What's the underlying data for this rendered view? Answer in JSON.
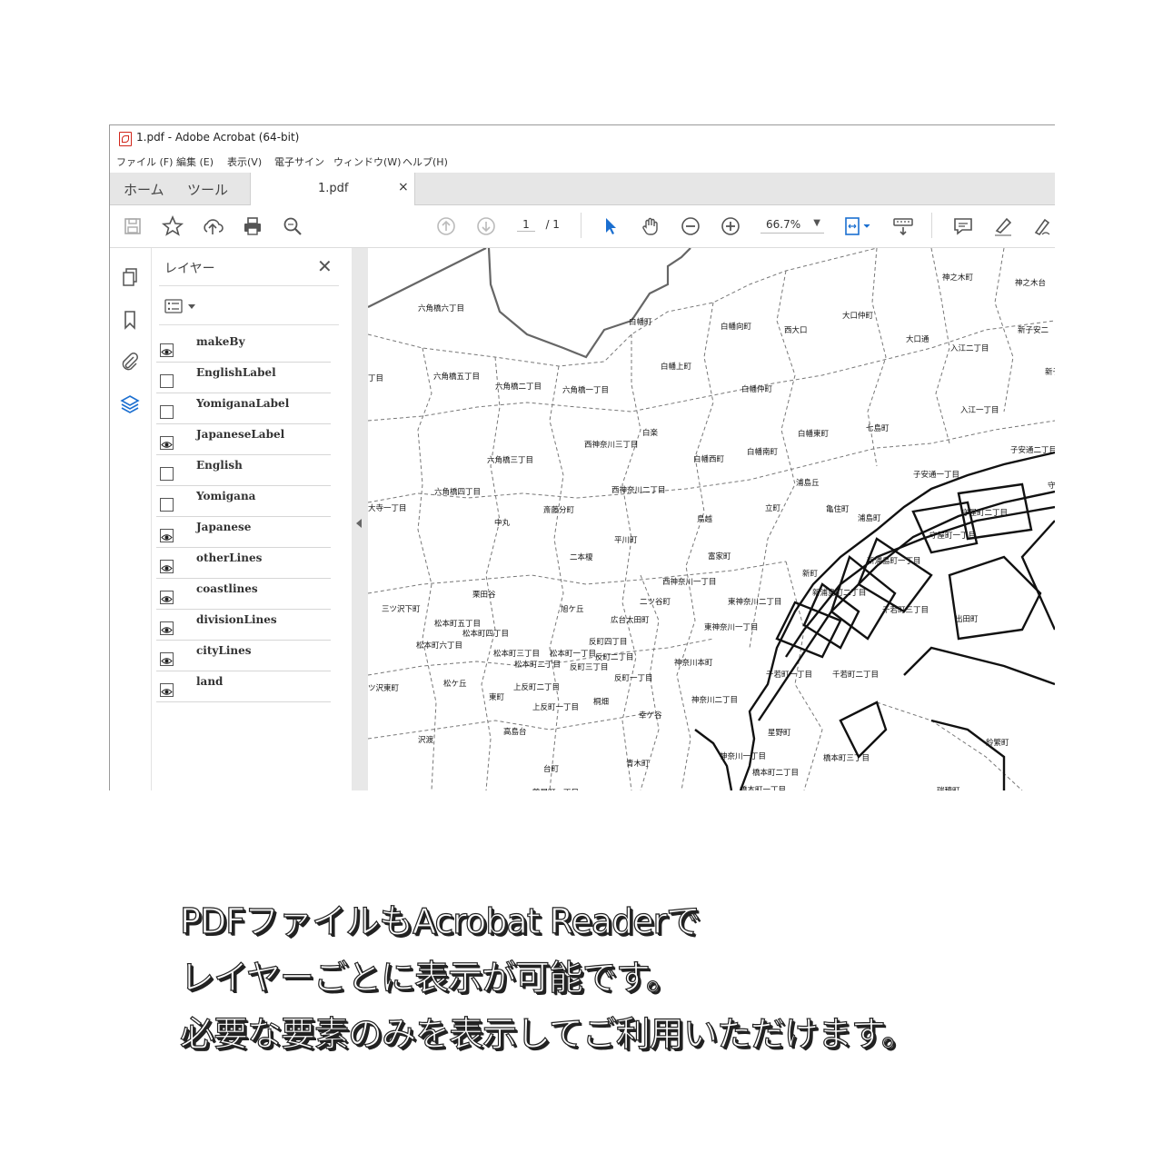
{
  "window": {
    "title": "1.pdf - Adobe Acrobat (64-bit)"
  },
  "menu": [
    "ファイル (F)",
    "編集 (E)",
    "表示(V)",
    "電子サイン",
    "ウィンドウ(W)",
    "ヘルプ(H)"
  ],
  "tabs": {
    "home": "ホーム",
    "tools": "ツール",
    "doc": "1.pdf",
    "doc_close": "×"
  },
  "toolbar": {
    "page_current": "1",
    "page_total": "/ 1",
    "zoom": "66.7%"
  },
  "panel": {
    "title": "レイヤー",
    "close": "✕"
  },
  "layers": [
    {
      "name": "makeBy",
      "visible": true
    },
    {
      "name": "EnglishLabel",
      "visible": false
    },
    {
      "name": "YomiganaLabel",
      "visible": false
    },
    {
      "name": "JapaneseLabel",
      "visible": true
    },
    {
      "name": "English",
      "visible": false
    },
    {
      "name": "Yomigana",
      "visible": false
    },
    {
      "name": "Japanese",
      "visible": true
    },
    {
      "name": "otherLines",
      "visible": true
    },
    {
      "name": "coastlines",
      "visible": true
    },
    {
      "name": "divisionLines",
      "visible": true
    },
    {
      "name": "cityLines",
      "visible": true
    },
    {
      "name": "land",
      "visible": true
    }
  ],
  "map_labels": [
    "六角橋六丁目",
    "白幡町",
    "白幡向町",
    "西大口",
    "大口仲町",
    "神之木町",
    "神之木台",
    "新子安二",
    "大口通",
    "入江二丁目",
    "新子",
    "丁目",
    "六角橋五丁目",
    "六角橋二丁目",
    "六角橋一丁目",
    "白幡上町",
    "白幡仲町",
    "入江一丁目",
    "白楽",
    "七島町",
    "白幡東町",
    "西神奈川三丁目",
    "白幡西町",
    "白幡南町",
    "子安通二丁目",
    "六角橋三丁目",
    "浦島丘",
    "子安通一丁目",
    "守",
    "西神奈川二丁目",
    "六角橋四丁目",
    "亀住町",
    "守屋町二丁目",
    "大寺一丁目",
    "斎藤分町",
    "立町",
    "浦島町",
    "守屋町一丁目",
    "中丸",
    "鳥越",
    "平川町",
    "二本榎",
    "富家町",
    "新浦島町一丁目",
    "西神奈川一丁目",
    "新町",
    "新浦島町二丁目",
    "三ツ沢下町",
    "栗田谷",
    "旭ケ丘",
    "二ツ谷町",
    "東神奈川二丁目",
    "千若町三丁目",
    "出田町",
    "広台太田町",
    "東神奈川一丁目",
    "松本町五丁目",
    "松本町四丁目",
    "松本町六丁目",
    "反町四丁目",
    "松本町三丁目",
    "松本町一丁目",
    "反町二丁目",
    "神奈川本町",
    "松本町二丁目",
    "反町三丁目",
    "千若町一丁目",
    "千若町二丁目",
    "ツ沢東町",
    "松ケ丘",
    "反町一丁目",
    "上反町二丁目",
    "東町",
    "上反町一丁目",
    "桐畑",
    "神奈川二丁目",
    "幸ケ谷",
    "沢渡",
    "高島台",
    "星野町",
    "神奈川一丁目",
    "橋本町三丁目",
    "鈴繁町",
    "台町",
    "青木町",
    "橋本町二丁目",
    "橋本町一丁目",
    "瑞穂町",
    "鶴屋町一丁目"
  ],
  "caption": [
    "PDFファイルもAcrobat Readerで",
    "レイヤーごとに表示が可能です。",
    "必要な要素のみを表示してご利用いただけます。"
  ]
}
